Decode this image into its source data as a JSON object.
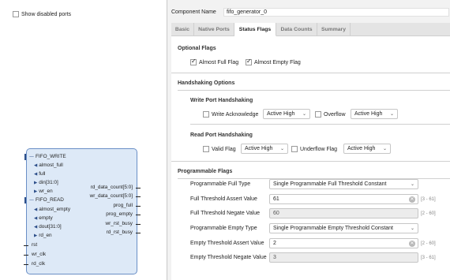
{
  "left": {
    "show_disabled_label": "Show disabled ports",
    "fifo_write": "FIFO_WRITE",
    "fifo_read": "FIFO_READ",
    "write_ports": [
      "almost_full",
      "full",
      "din[31:0]",
      "wr_en"
    ],
    "read_ports": [
      "almost_empty",
      "empty",
      "dout[31:0]",
      "rd_en"
    ],
    "plain_ports": [
      "rst",
      "wr_clk",
      "rd_clk"
    ],
    "right_ports": [
      "rd_data_count[5:0]",
      "wr_data_count[5:0]",
      "prog_full",
      "prog_empty",
      "wr_rst_busy",
      "rd_rst_busy"
    ]
  },
  "header": {
    "component_name_label": "Component Name",
    "component_name_value": "fifo_generator_0"
  },
  "tabs": [
    "Basic",
    "Native Ports",
    "Status Flags",
    "Data Counts",
    "Summary"
  ],
  "active_tab": "Status Flags",
  "optional_flags": {
    "title": "Optional Flags",
    "almost_full": "Almost Full Flag",
    "almost_empty": "Almost Empty Flag"
  },
  "handshaking": {
    "title": "Handshaking Options",
    "write_title": "Write Port Handshaking",
    "write_ack": "Write Acknowledge",
    "write_ack_level": "Active High",
    "overflow": "Overflow",
    "overflow_level": "Active High",
    "read_title": "Read Port Handshaking",
    "valid": "Valid Flag",
    "valid_level": "Active High",
    "underflow": "Underflow Flag",
    "underflow_level": "Active High"
  },
  "programmable": {
    "title": "Programmable Flags",
    "full_type_label": "Programmable Full Type",
    "full_type_value": "Single Programmable Full Threshold Constant",
    "full_assert_label": "Full Threshold Assert Value",
    "full_assert_value": "61",
    "full_assert_range": "[3 - 61]",
    "full_negate_label": "Full Threshold Negate Value",
    "full_negate_value": "60",
    "full_negate_range": "[2 - 60]",
    "empty_type_label": "Programmable Empty Type",
    "empty_type_value": "Single Programmable Empty Threshold Constant",
    "empty_assert_label": "Empty Threshold Assert Value",
    "empty_assert_value": "2",
    "empty_assert_range": "[2 - 60]",
    "empty_negate_label": "Empty Threshold Negate Value",
    "empty_negate_value": "3",
    "empty_negate_range": "[3 - 61]"
  }
}
